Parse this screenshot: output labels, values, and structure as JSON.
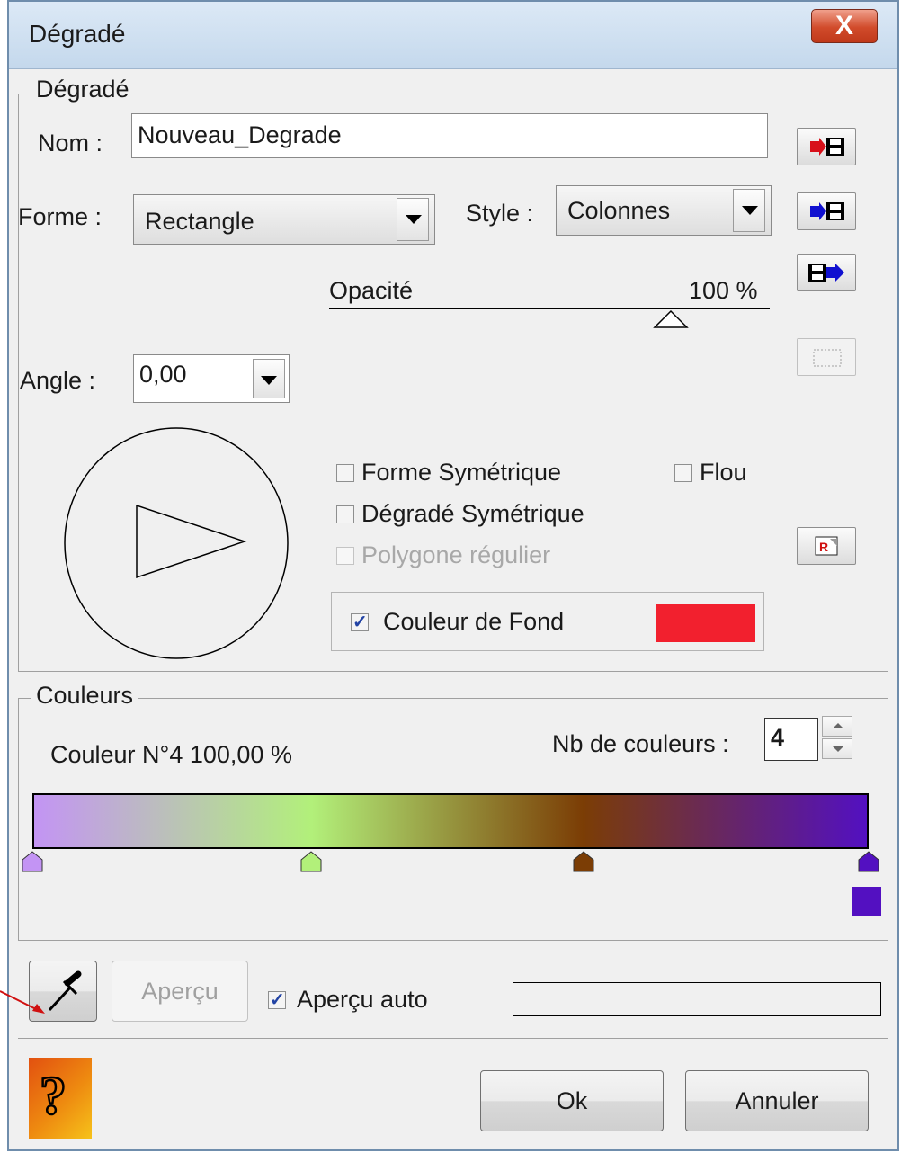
{
  "window": {
    "title": "Dégradé",
    "close_label": "X"
  },
  "degrade_group": {
    "legend": "Dégradé",
    "nom_label": "Nom :",
    "nom_value": "Nouveau_Degrade",
    "forme_label": "Forme :",
    "forme_value": "Rectangle",
    "style_label": "Style :",
    "style_value": "Colonnes",
    "opacite_label": "Opacité",
    "opacite_value": "100 %",
    "opacite_level": 1.0,
    "angle_label": "Angle :",
    "angle_value": "0,00",
    "forme_symetrique": {
      "label": "Forme Symétrique",
      "checked": false
    },
    "flou": {
      "label": "Flou",
      "checked": false
    },
    "degrade_symetrique": {
      "label": "Dégradé Symétrique",
      "checked": false
    },
    "polygone_regulier": {
      "label": "Polygone régulier",
      "checked": false,
      "disabled": true
    },
    "couleur_de_fond": {
      "label": "Couleur de Fond",
      "checked": true,
      "color": "#f2202e"
    }
  },
  "side_buttons": [
    "import-save-icon",
    "import-save-blue-icon",
    "export-save-icon",
    "dotted-rect-icon",
    "report-icon"
  ],
  "couleurs_group": {
    "legend": "Couleurs",
    "couleur_info": "Couleur N°4 100,00 %",
    "nb_label": "Nb de couleurs :",
    "nb_value": "4",
    "stops": [
      {
        "pos": 0.0,
        "color": "#c394f4"
      },
      {
        "pos": 0.333,
        "color": "#b2f07a"
      },
      {
        "pos": 0.659,
        "color": "#7b3d05"
      },
      {
        "pos": 1.0,
        "color": "#5310c1"
      }
    ],
    "selected_color": "#5310c1"
  },
  "bottom": {
    "apercu_label": "Aperçu",
    "apercu_auto_label": "Aperçu auto",
    "apercu_auto_checked": true,
    "ok_label": "Ok",
    "annuler_label": "Annuler"
  },
  "colors": {
    "arrow_annotation": "#d01010"
  }
}
